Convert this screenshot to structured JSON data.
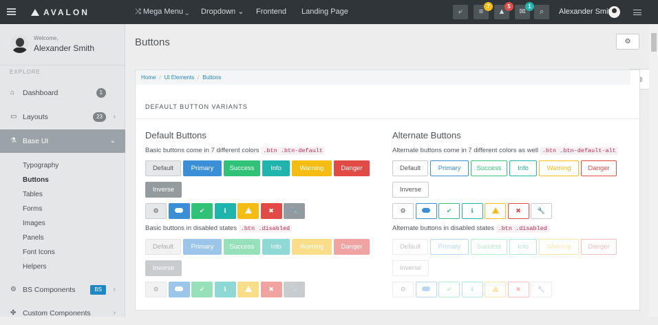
{
  "brand": {
    "name": "AVALON"
  },
  "topnav": {
    "mega_menu": "Mega Menu",
    "dropdown": "Dropdown",
    "frontend": "Frontend",
    "landing": "Landing Page",
    "badges": {
      "tasks": "7",
      "notifications": "5",
      "messages": "1"
    },
    "user_name": "Alexander Smith"
  },
  "sidebar": {
    "welcome": "Welcome,",
    "user_name": "Alexander Smith",
    "section": "EXPLORE",
    "items": [
      {
        "label": "Dashboard",
        "count": "1"
      },
      {
        "label": "Layouts",
        "count": "23"
      },
      {
        "label": "Base UI"
      },
      {
        "label": "BS Components",
        "badge": "BS"
      },
      {
        "label": "Custom Components"
      }
    ],
    "subitems": [
      "Typography",
      "Buttons",
      "Tables",
      "Forms",
      "Images",
      "Panels",
      "Font Icons",
      "Helpers"
    ]
  },
  "page": {
    "title": "Buttons",
    "breadcrumb": [
      "Home",
      "UI Elements",
      "Buttons"
    ],
    "panel_title": "DEFAULT BUTTON VARIANTS"
  },
  "left": {
    "heading": "Default Buttons",
    "desc1": "Basic buttons come in 7 different colors",
    "code1": ".btn .btn-default",
    "desc2": "Basic buttons in disabled states",
    "code2": ".btn .disabled",
    "buttons": [
      "Default",
      "Primary",
      "Success",
      "Info",
      "Warning",
      "Danger",
      "Inverse"
    ]
  },
  "right": {
    "heading": "Alternate Buttons",
    "desc1": "Alternate buttons come in 7 different colors as well",
    "code1": ".btn .btn-default-alt",
    "desc2": "Alternate buttons in disabled states",
    "code2": ".btn .disabled",
    "buttons": [
      "Default",
      "Primary",
      "Success",
      "Info",
      "Warning",
      "Danger",
      "Inverse"
    ]
  },
  "icons": [
    "gear-icon",
    "cloud-icon",
    "check-icon",
    "info-icon",
    "warning-icon",
    "close-icon",
    "wrench-icon"
  ],
  "colors": {
    "default": "#e6e7e8",
    "primary": "#3a8fd7",
    "success": "#30c378",
    "info": "#1fb5ac",
    "warning": "#f5bd13",
    "danger": "#e24a45",
    "inverse": "#939b9e",
    "topbar": "#2f3538"
  }
}
